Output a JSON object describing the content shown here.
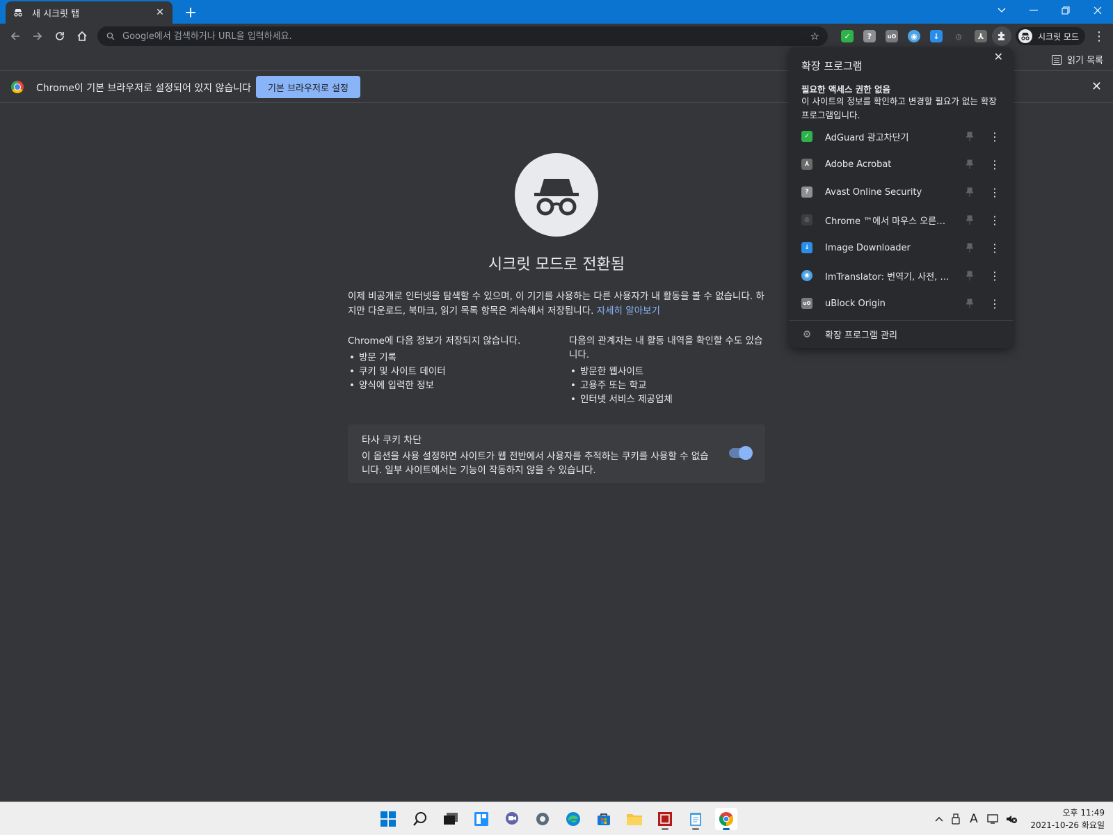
{
  "tab": {
    "title": "새 시크릿 탭"
  },
  "omnibox": {
    "placeholder": "Google에서 검색하거나 URL을 입력하세요."
  },
  "profile": {
    "label": "시크릿 모드"
  },
  "bookmarks_bar": {
    "reading_list": "읽기 목록"
  },
  "infobar": {
    "message": "Chrome이 기본 브라우저로 설정되어 있지 않습니다",
    "button": "기본 브라우저로 설정"
  },
  "incognito": {
    "title": "시크릿 모드로 전환됨",
    "description": "이제 비공개로 인터넷을 탐색할 수 있으며, 이 기기를 사용하는 다른 사용자가 내 활동을 볼 수 없습니다. 하지만 다운로드, 북마크, 읽기 목록 항목은 계속해서 저장됩니다.",
    "learn_more": "자세히 알아보기",
    "not_saved_head": "Chrome에 다음 정보가 저장되지 않습니다.",
    "not_saved": [
      "방문 기록",
      "쿠키 및 사이트 데이터",
      "양식에 입력한 정보"
    ],
    "visible_to_head": "다음의 관계자는 내 활동 내역을 확인할 수도 있습니다.",
    "visible_to": [
      "방문한 웹사이트",
      "고용주 또는 학교",
      "인터넷 서비스 제공업체"
    ],
    "cookie_title": "타사 쿠키 차단",
    "cookie_desc": "이 옵션을 사용 설정하면 사이트가 웹 전반에서 사용자를 추적하는 쿠키를 사용할 수 없습니다. 일부 사이트에서는 기능이 작동하지 않을 수 있습니다."
  },
  "extensions_menu": {
    "title": "확장 프로그램",
    "section_head": "필요한 액세스 권한 없음",
    "section_desc": "이 사이트의 정보를 확인하고 변경할 필요가 없는 확장 프로그램입니다.",
    "items": [
      {
        "name": "AdGuard 광고차단기",
        "color": "#2eb34b"
      },
      {
        "name": "Adobe Acrobat",
        "color": "#6b6b6b"
      },
      {
        "name": "Avast Online Security",
        "color": "#8e8f93"
      },
      {
        "name": "Chrome ™에서 마우스 오른쪽...",
        "color": "#3c3d41"
      },
      {
        "name": "Image Downloader",
        "color": "#2a8ee8"
      },
      {
        "name": "ImTranslator: 번역기, 사전, 음성",
        "color": "#4da3e8"
      },
      {
        "name": "uBlock Origin",
        "color": "#7a7b80"
      }
    ],
    "manage": "확장 프로그램 관리"
  },
  "clock": {
    "time": "오후 11:49",
    "date": "2021-10-26 화요일"
  }
}
